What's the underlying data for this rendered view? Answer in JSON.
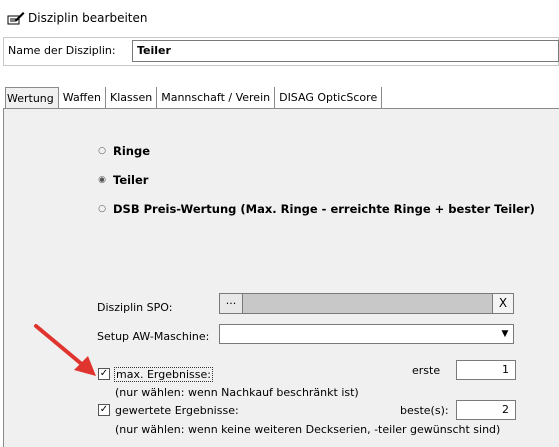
{
  "window": {
    "title": "Disziplin bearbeiten",
    "icon": "edit-discipline-icon"
  },
  "name_field": {
    "label": "Name der Disziplin:",
    "value": "Teiler"
  },
  "tabs": [
    {
      "label": "Wertung",
      "active": true
    },
    {
      "label": "Waffen",
      "active": false
    },
    {
      "label": "Klassen",
      "active": false
    },
    {
      "label": "Mannschaft / Verein",
      "active": false
    },
    {
      "label": "DISAG OpticScore",
      "active": false
    }
  ],
  "wertung": {
    "options": [
      {
        "label": "Ringe",
        "selected": false
      },
      {
        "label": "Teiler",
        "selected": true
      },
      {
        "label": "DSB Preis-Wertung (Max. Ringe - erreichte Ringe + bester Teiler)",
        "selected": false
      }
    ],
    "spo": {
      "label": "Disziplin SPO:",
      "browse_label": "...",
      "clear_label": "X",
      "value": ""
    },
    "setup": {
      "label": "Setup AW-Maschine:",
      "value": "",
      "arrow": "▼"
    },
    "max_results": {
      "checked": true,
      "label": "max. Ergebnisse:",
      "hint": "(nur wählen: wenn Nachkauf beschränkt ist)",
      "value_label": "erste",
      "value": "1"
    },
    "counted_results": {
      "checked": true,
      "label": "gewertete Ergebnisse:",
      "hint": "(nur wählen: wenn keine weiteren Deckserien, -teiler gewünscht sind)",
      "value_label": "beste(s):",
      "value": "2"
    }
  },
  "colors": {
    "panel_bg": "#f0f0f0",
    "arrow": "#e0342e",
    "disabled_field": "#c8c8c8"
  }
}
